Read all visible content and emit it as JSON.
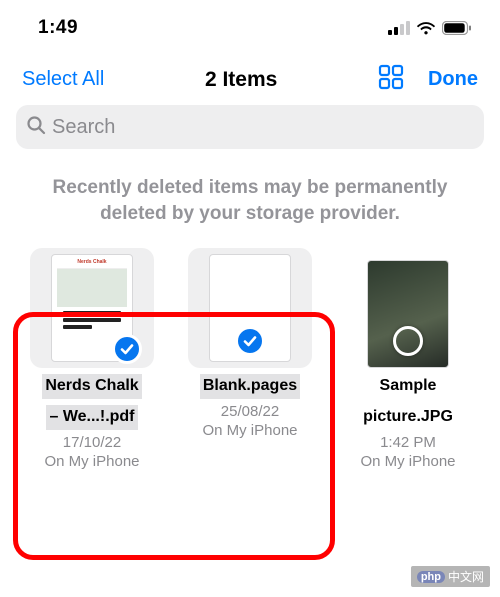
{
  "status_bar": {
    "time": "1:49"
  },
  "nav": {
    "select_all": "Select All",
    "title": "2 Items",
    "done": "Done"
  },
  "search": {
    "placeholder": "Search"
  },
  "info_text": "Recently deleted items may be permanently deleted by your storage provider.",
  "files": [
    {
      "name_line1": "Nerds Chalk",
      "name_line2": "– We...!.pdf",
      "date": "17/10/22",
      "location": "On My iPhone",
      "selected": true,
      "thumb_logo": "Nerds Chalk"
    },
    {
      "name_line1": "Blank.pages",
      "name_line2": "",
      "date": "25/08/22",
      "location": "On My iPhone",
      "selected": true
    },
    {
      "name_line1": "Sample",
      "name_line2": "picture.JPG",
      "date": "1:42 PM",
      "location": "On My iPhone",
      "selected": false
    }
  ],
  "watermark": {
    "badge": "php",
    "text": "中文网"
  }
}
